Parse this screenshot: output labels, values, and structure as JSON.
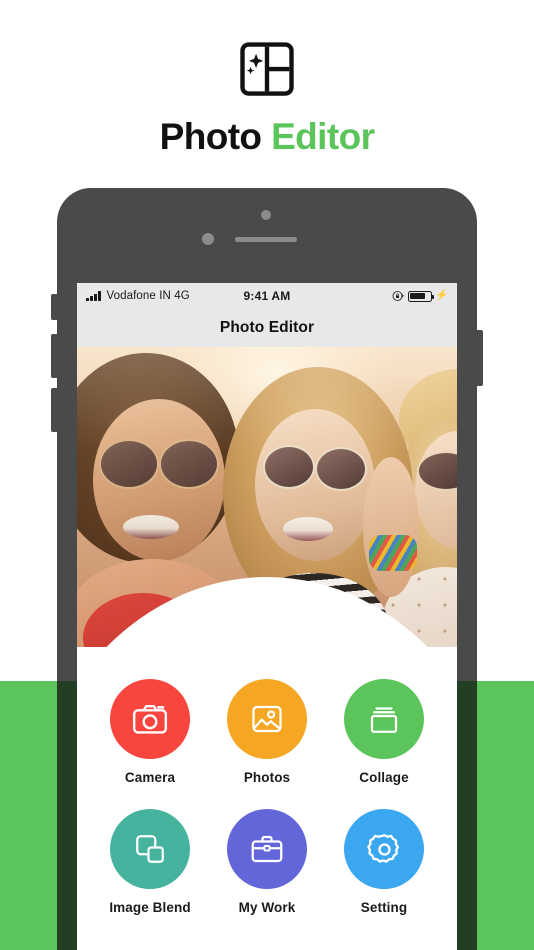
{
  "brand": {
    "logo_icon": "photo-collage-logo-icon",
    "title_primary": "Photo ",
    "title_accent": "Editor",
    "accent_color": "#5BC45B"
  },
  "background": {
    "band_color": "#5BC45B",
    "page_color": "#FFFFFF"
  },
  "phone": {
    "body_color": "#4A4A4A",
    "speaker_icon": "earpiece-speaker-icon",
    "front_camera_icon": "front-camera-icon",
    "sensor_icon": "proximity-sensor-icon",
    "buttons": [
      "mute-switch",
      "volume-up",
      "volume-down",
      "power"
    ]
  },
  "status_bar": {
    "signal_icon": "cellular-signal-icon",
    "carrier": "Vodafone IN 4G",
    "time": "9:41 AM",
    "rotation_lock_icon": "rotation-lock-icon",
    "battery_icon": "battery-icon",
    "charging_icon": "lightning-bolt-icon",
    "background_color": "#E8E8E8"
  },
  "app_header": {
    "title": "Photo Editor",
    "background_color": "#E8E8E8"
  },
  "hero": {
    "description": "Three smiling women wearing sunglasses outdoors in warm sunlight"
  },
  "actions": {
    "rows": [
      [
        {
          "label": "Camera",
          "icon": "camera-icon",
          "color": "#F8463F"
        },
        {
          "label": "Photos",
          "icon": "image-icon",
          "color": "#F5A623"
        },
        {
          "label": "Collage",
          "icon": "collage-icon",
          "color": "#5BC45B"
        }
      ],
      [
        {
          "label": "Image Blend",
          "icon": "layers-icon",
          "color": "#45B39D"
        },
        {
          "label": "My Work",
          "icon": "briefcase-icon",
          "color": "#6366D8"
        },
        {
          "label": "Setting",
          "icon": "gear-icon",
          "color": "#3BA7F0"
        }
      ]
    ]
  }
}
